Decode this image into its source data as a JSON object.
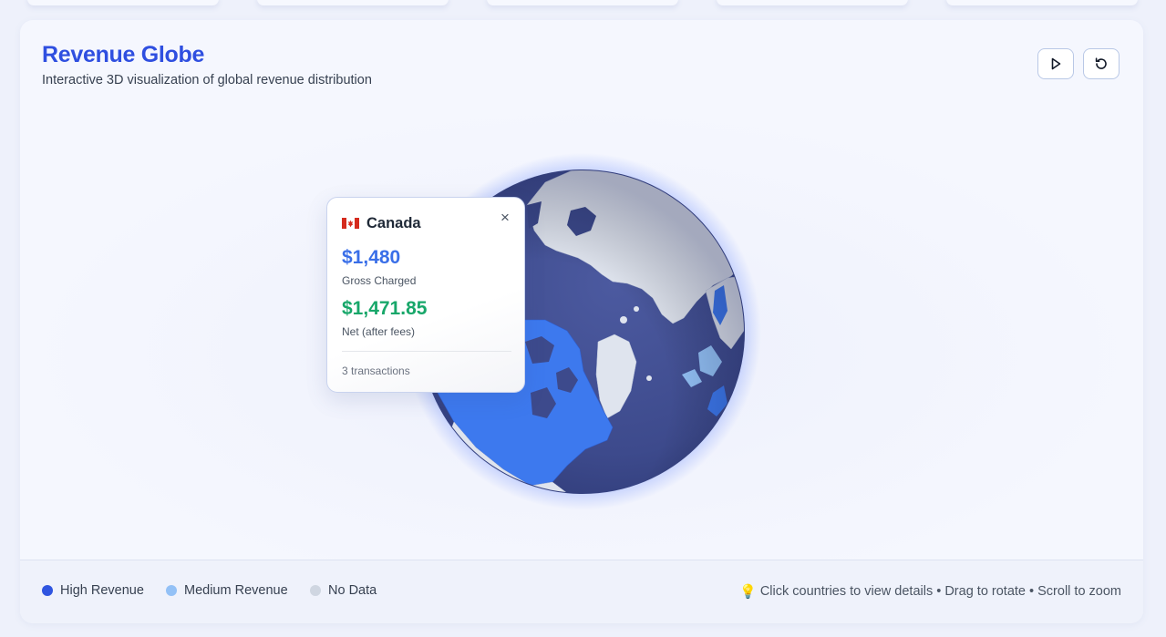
{
  "header": {
    "title": "Revenue Globe",
    "subtitle": "Interactive 3D visualization of global revenue distribution"
  },
  "controls": {
    "play_icon": "play-icon",
    "reset_icon": "rotate-ccw-icon"
  },
  "tooltip": {
    "country": "Canada",
    "flag_icon": "canada-flag-icon",
    "gross": "$1,480",
    "gross_label": "Gross Charged",
    "net": "$1,471.85",
    "net_label": "Net (after fees)",
    "transactions": "3 transactions",
    "close_symbol": "×"
  },
  "legend": [
    {
      "label": "High Revenue",
      "color": "#2f55e0"
    },
    {
      "label": "Medium Revenue",
      "color": "#93c1f6"
    },
    {
      "label": "No Data",
      "color": "#cfd6e1"
    }
  ],
  "hint": {
    "icon": "💡",
    "text": "Click countries to view details • Drag to rotate • Scroll to zoom"
  },
  "colors": {
    "accent": "#2f4fe0",
    "gross": "#3a6fe8",
    "net": "#18a76a",
    "ocean": "#3f4d8f",
    "land_no_data": "#dfe4ee",
    "land_high": "#3d79ee",
    "land_medium": "#93c1f6"
  }
}
